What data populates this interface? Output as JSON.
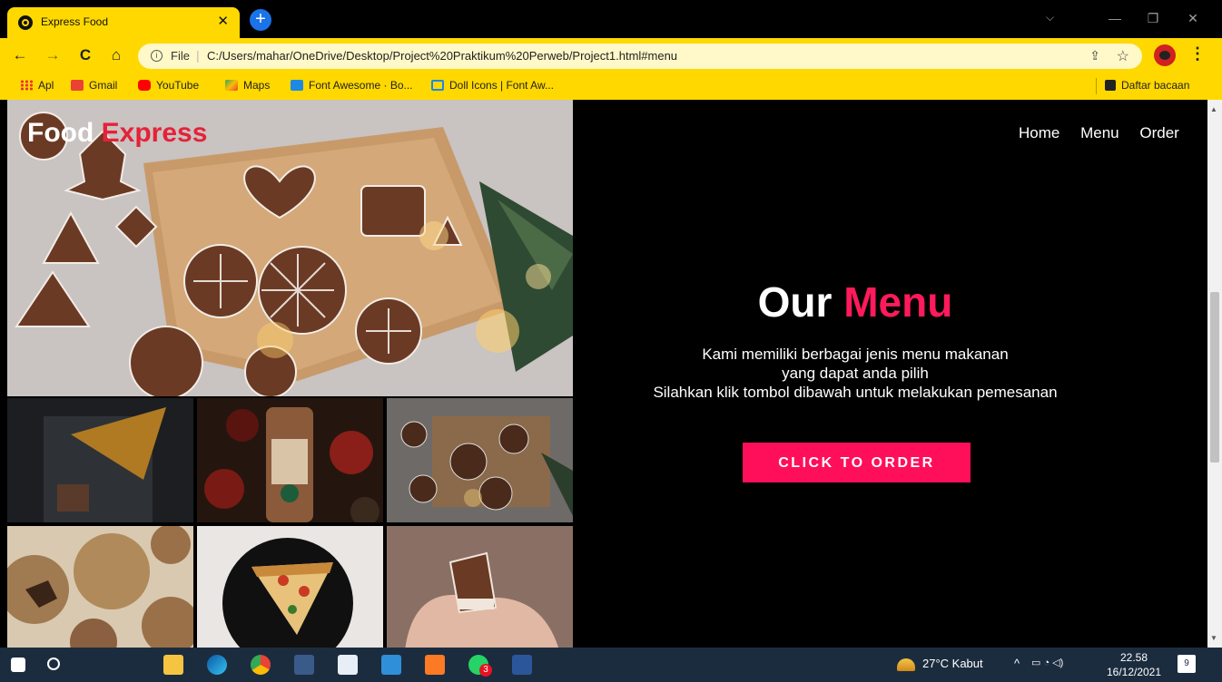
{
  "browser": {
    "tab_title": "Express Food",
    "tab_close": "✕",
    "new_tab": "+",
    "tab_search": "⌵",
    "window_controls": {
      "minimize": "—",
      "restore": "❐",
      "close": "✕"
    },
    "nav": {
      "back": "←",
      "forward": "→",
      "reload": "C",
      "home": "⌂"
    },
    "omnibox": {
      "info_icon": "i",
      "scheme_label": "File",
      "separator": "|",
      "url": "C:/Users/mahar/OneDrive/Desktop/Project%20Praktikum%20Perweb/Project1.html#menu"
    },
    "share_icon": "⇪",
    "star_icon": "☆",
    "menu_icon": "⋮",
    "bookmarks": [
      {
        "label": "Apl",
        "icon": "apps-grid-icon",
        "color": "#e53935"
      },
      {
        "label": "Gmail",
        "icon": "gmail-icon",
        "color": "#ea4335"
      },
      {
        "label": "YouTube",
        "icon": "youtube-icon",
        "color": "#ff0000"
      },
      {
        "label": "Maps",
        "icon": "maps-icon",
        "color": "#34a853"
      },
      {
        "label": "Font Awesome · Bo...",
        "icon": "bootstrap-icon",
        "color": "#1e88e5"
      },
      {
        "label": "Doll Icons | Font Aw...",
        "icon": "flag-icon",
        "color": "#1e88e5"
      }
    ],
    "reading_list": "Daftar bacaan"
  },
  "page": {
    "logo_part1": "Food",
    "logo_part2": "Express",
    "nav": [
      "Home",
      "Menu",
      "Order"
    ],
    "heading_part1": "Our",
    "heading_part2": "Menu",
    "description_lines": [
      "Kami memiliki berbagai jenis menu makanan",
      "yang dapat anda pilih",
      "Silahkan klik tombol dibawah untuk melakukan pemesanan"
    ],
    "cta": "CLICK TO ORDER",
    "colors": {
      "accent_logo": "#e52238",
      "accent_heading": "#ff1a5b",
      "button": "#ff0f5a",
      "chrome": "#ffd800"
    }
  },
  "taskbar": {
    "apps": [
      "start-icon",
      "search-icon",
      "file-explorer-icon",
      "edge-icon",
      "chrome-icon",
      "screen-capture-icon",
      "notepad-icon",
      "vscode-icon",
      "xampp-icon",
      "whatsapp-icon",
      "word-icon"
    ],
    "whatsapp_badge": "3",
    "weather": "27°C  Kabut",
    "tray_icons": "^",
    "time": "22.58",
    "date": "16/12/2021",
    "notification_count": "9"
  }
}
